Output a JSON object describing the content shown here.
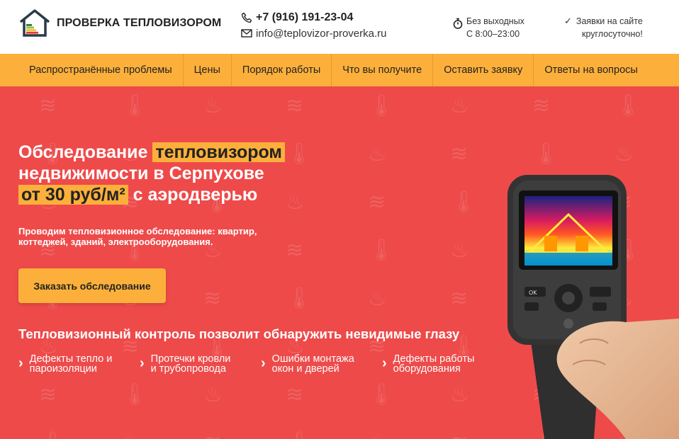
{
  "header": {
    "logo_text": "ПРОВЕРКА ТЕПЛОВИЗОРОМ",
    "phone": "+7 (916) 191-23-04",
    "email": "info@teplovizor-proverka.ru",
    "hours_line1": "Без выходных",
    "hours_line2": "С 8:00–23:00",
    "requests_line1": "Заявки на сайте",
    "requests_line2": "круглосуточно!"
  },
  "nav": {
    "items": [
      {
        "label": "Распространённые проблемы"
      },
      {
        "label": "Цены"
      },
      {
        "label": "Порядок работы"
      },
      {
        "label": "Что вы получите"
      },
      {
        "label": "Оставить заявку"
      },
      {
        "label": "Ответы на вопросы"
      }
    ]
  },
  "hero": {
    "title_part1": "Обследование",
    "title_highlight1": "тепловизором",
    "title_part2": "недвижимости в Серпухове",
    "title_highlight2": "от 30 руб/м²",
    "title_part3": "с аэродверью",
    "subtitle": "Проводим тепловизионное обследование: квартир, коттеджей, зданий, электрооборудования.",
    "cta_label": "Заказать обследование",
    "benefits_heading": "Тепловизионный контроль позволит обнаружить невидимые глазу",
    "benefits": [
      {
        "line1": "Дефекты тепло и",
        "line2": "пароизоляции"
      },
      {
        "line1": "Протечки кровли",
        "line2": "и трубопровода"
      },
      {
        "line1": "Ошибки монтажа",
        "line2": "окон и дверей"
      },
      {
        "line1": "Дефекты работы",
        "line2": "оборудования"
      }
    ]
  },
  "camera": {
    "button_ok": "OK"
  },
  "colors": {
    "hero_bg": "#ee4a4a",
    "accent": "#fcb03b",
    "header_bg": "#ffffff"
  },
  "icons": [
    "house-logo-icon",
    "phone-icon",
    "mail-icon",
    "stopwatch-icon",
    "check-icon",
    "chevron-right-icon",
    "thermometer-icon",
    "radiator-icon",
    "heat-waves-icon"
  ]
}
